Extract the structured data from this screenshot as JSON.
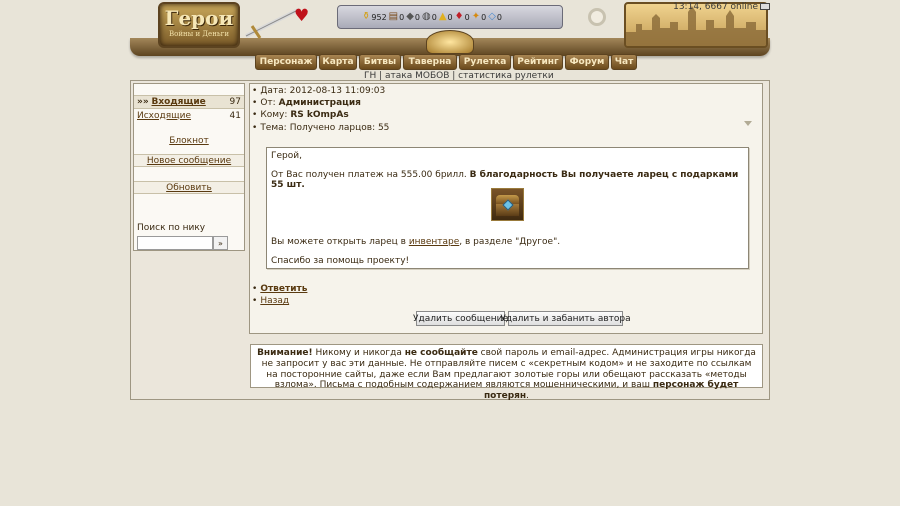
{
  "header": {
    "logo": {
      "title": "Герои",
      "subtitle": "Войны и Деньги"
    },
    "stats": [
      {
        "icon": "gold-icon",
        "glyph": "⚱",
        "value": "952"
      },
      {
        "icon": "wood-icon",
        "glyph": "▤",
        "value": "0"
      },
      {
        "icon": "ore-icon",
        "glyph": "◆",
        "value": "0"
      },
      {
        "icon": "mercury-icon",
        "glyph": "◍",
        "value": "0"
      },
      {
        "icon": "sulfur-icon",
        "glyph": "▲",
        "value": "0"
      },
      {
        "icon": "crystal-icon",
        "glyph": "♦",
        "value": "0"
      },
      {
        "icon": "gems-icon",
        "glyph": "✦",
        "value": "0"
      },
      {
        "icon": "diamond-icon",
        "glyph": "◇",
        "value": "0"
      }
    ],
    "time_online": "13:14, 6667 online"
  },
  "nav": {
    "tabs": [
      "Персонаж",
      "Карта",
      "Битвы",
      "Таверна",
      "Рулетка",
      "Рейтинг",
      "Форум",
      "Чат"
    ],
    "sub": {
      "gn": "ГН",
      "sep1": " | ",
      "mobs": "атака МОБОВ",
      "sep2": " | ",
      "roulette_stats": "статистика рулетки"
    }
  },
  "sidebar": {
    "inbox_label": "Входящие",
    "inbox_prefix": "»»",
    "inbox_count": "97",
    "outbox_label": "Исходящие",
    "outbox_count": "41",
    "notepad": "Блокнот",
    "new_message": "Новое сообщение",
    "refresh": "Обновить",
    "search_label": "Поиск по нику",
    "search_value": "",
    "search_button": "»"
  },
  "message": {
    "date_label": "Дата:",
    "date_value": "2012-08-13 11:09:03",
    "from_label": "От:",
    "from_value": "Администрация",
    "to_label": "Кому:",
    "to_value": "RS kOmpAs",
    "subject_label": "Тема:",
    "subject_value": "Получено ларцов: 55",
    "greeting": "Герой,",
    "body_line1_prefix": "От Вас получен платеж на 555.00 брилл. ",
    "body_line1_bold": "В благодарность Вы получаете ларец с подарками 55 шт.",
    "body_line2_prefix": "Вы можете открыть ларец в ",
    "inventory_link": "инвентаре",
    "body_line2_suffix": ", в разделе \"Другое\".",
    "thanks": "Спасибо за помощь проекту!",
    "reply": "Ответить",
    "back": "Назад",
    "delete_button": "Удалить сообщение",
    "delete_ban_button": "Удалить и забанить автора"
  },
  "warning": {
    "bold1": "Внимание!",
    "text1": " Никому и никогда ",
    "bold2": "не сообщайте",
    "text2": " свой пароль и email-адрес. Администрация игры никогда не запросит у вас эти данные. Не отправляйте писем с «секретным кодом» и не заходите по ссылкам на посторонние сайты, даже если Вам предлагают золотые горы или обещают рассказать «методы взлома». Письма с подобным содержанием являются мошенническими, и ваш ",
    "bold3": "персонаж будет потерян",
    "text3": "."
  }
}
